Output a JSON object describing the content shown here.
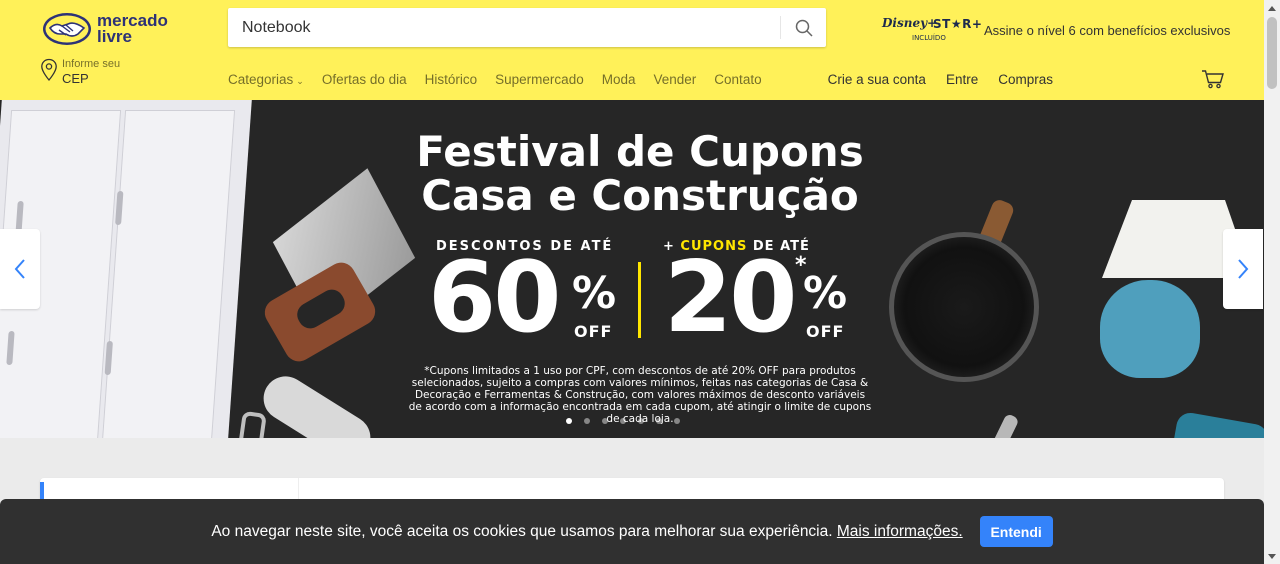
{
  "header": {
    "logo_line1": "mercado",
    "logo_line2": "livre",
    "search": {
      "value": "Notebook",
      "placeholder": ""
    },
    "promo": {
      "badge_brand": "Disney+",
      "badge_star": "ST★R+",
      "badge_sub": "INCLUÍDO",
      "text": "Assine o nível 6 com benefícios exclusivos"
    },
    "cep": {
      "label_small": "Informe seu",
      "label_big": "CEP"
    },
    "nav": [
      {
        "label": "Categorias"
      },
      {
        "label": "Ofertas do dia"
      },
      {
        "label": "Histórico"
      },
      {
        "label": "Supermercado"
      },
      {
        "label": "Moda"
      },
      {
        "label": "Vender"
      },
      {
        "label": "Contato"
      }
    ],
    "user_nav": [
      {
        "label": "Crie a sua conta"
      },
      {
        "label": "Entre"
      },
      {
        "label": "Compras"
      }
    ]
  },
  "banner": {
    "title_line1": "Festival de Cupons",
    "title_line2": "Casa e Construção",
    "discount_label": "DESCONTOS DE ATÉ",
    "coupons_prefix": "+ ",
    "coupons_highlight": "CUPONS",
    "coupons_suffix": " DE ATÉ",
    "discount_value": "60",
    "coupon_value": "20",
    "percent": "%",
    "off": "OFF",
    "asterisk": "*",
    "fineprint": "*Cupons limitados a 1 uso por CPF, com descontos de até 20% OFF para produtos selecionados, sujeito a compras com valores mínimos, feitas nas categorias de Casa & Decoração e Ferramentas & Construção, com valores máximos de desconto variáveis de acordo com a informação encontrada em cada cupom, até atingir o limite de cupons de cada loja.",
    "slide_count": 7,
    "active_slide": 1
  },
  "cookie": {
    "text": "Ao navegar neste site, você aceita os cookies que usamos para melhorar sua experiência.",
    "link": "Mais informações.",
    "button": "Entendi"
  },
  "colors": {
    "header_bg": "#fff159",
    "brand_blue": "#2d3277",
    "accent": "#3483fa",
    "highlight": "#ffe600",
    "banner_bg": "#262626",
    "cookie_bg": "#303030"
  },
  "icons": {
    "logo": "handshake-logo-icon",
    "search": "magnifier-icon",
    "location": "location-pin-icon",
    "cart": "shopping-cart-icon",
    "prev": "chevron-left-icon",
    "next": "chevron-right-icon"
  }
}
